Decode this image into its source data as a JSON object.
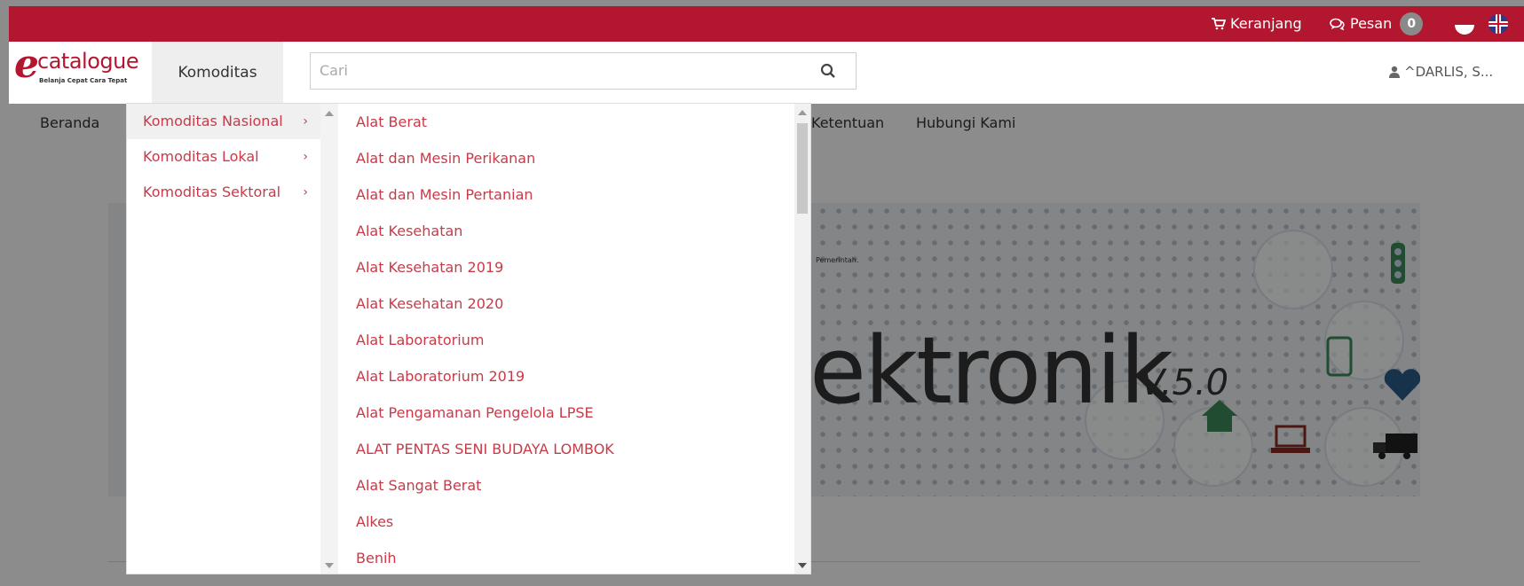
{
  "topbar": {
    "cart_label": "Keranjang",
    "messages_label": "Pesan",
    "messages_count": "0",
    "color": "#b3162f"
  },
  "header": {
    "logo_name": "catalogue",
    "logo_tagline": "Belanja Cepat Cara Tepat",
    "komoditas_tab": "Komoditas",
    "search_placeholder": "Cari",
    "user_label": "^DARLIS, S..."
  },
  "nav": {
    "items": [
      "Beranda",
      "Ketentuan",
      "Hubungi Kami"
    ]
  },
  "banner": {
    "headline": "ektronik",
    "version": "V.5.0",
    "fine_print": "Pemerintah."
  },
  "dropdown": {
    "categories": [
      {
        "label": "Komoditas Nasional",
        "active": true
      },
      {
        "label": "Komoditas Lokal",
        "active": false
      },
      {
        "label": "Komoditas Sektoral",
        "active": false
      }
    ],
    "items": [
      "Alat Berat",
      "Alat dan Mesin Perikanan",
      "Alat dan Mesin Pertanian",
      "Alat Kesehatan",
      "Alat Kesehatan 2019",
      "Alat Kesehatan 2020",
      "Alat Laboratorium",
      "Alat Laboratorium 2019",
      "Alat Pengamanan Pengelola LPSE",
      "ALAT PENTAS SENI BUDAYA LOMBOK",
      "Alat Sangat Berat",
      "Alkes",
      "Benih"
    ],
    "link_color": "#c93a48"
  }
}
